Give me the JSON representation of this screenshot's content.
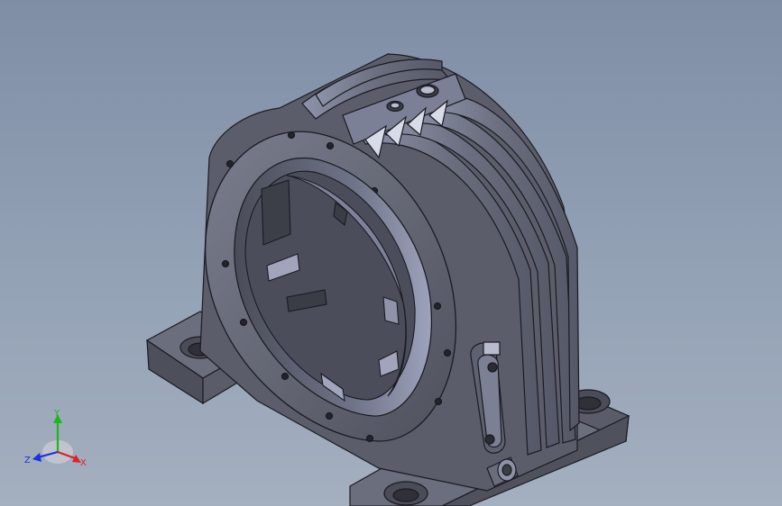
{
  "viewport": {
    "background_top": "#7f8ea5",
    "background_bottom": "#a4afbf"
  },
  "model": {
    "body_color": "#5b5e6a",
    "face_color": "#6d7080",
    "highlight_color": "#9aa0b8",
    "edge_color": "#1a1b22"
  },
  "triad": {
    "x_label": "X",
    "y_label": "Y",
    "z_label": "Z",
    "x_color": "#e0202a",
    "y_color": "#1ab81a",
    "z_color": "#2030e0"
  }
}
